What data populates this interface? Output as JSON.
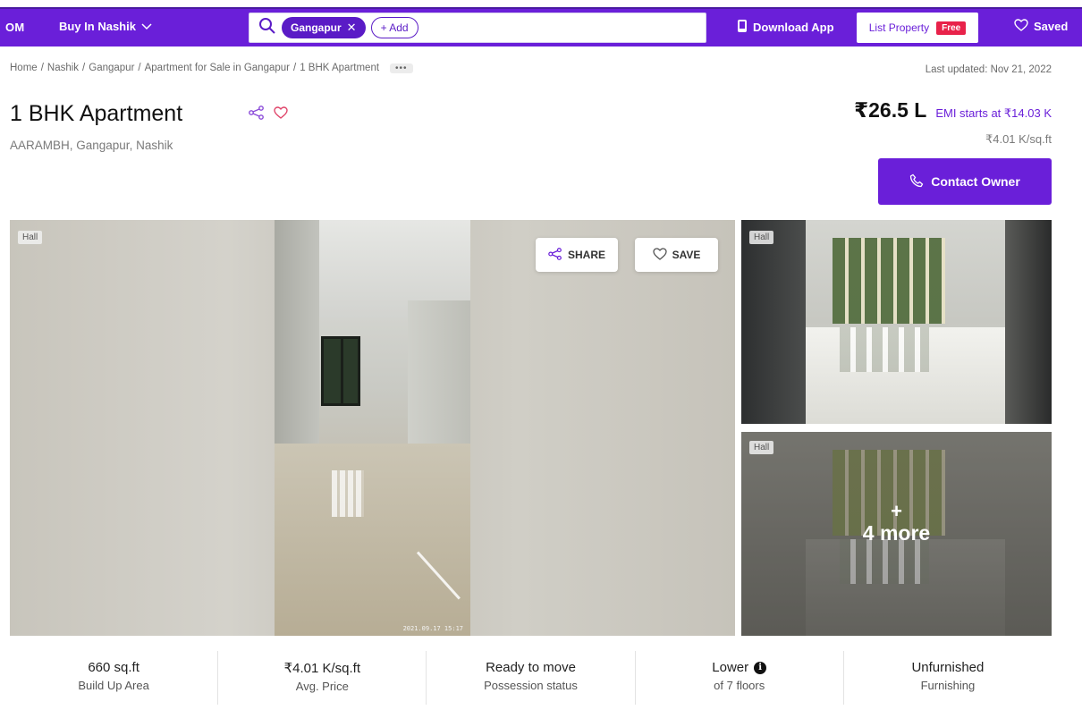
{
  "nav": {
    "brand": "OM",
    "city": "Buy In Nashik",
    "search_chip": "Gangapur",
    "add_label": "+ Add",
    "download_app": "Download App",
    "list_property": "List Property",
    "free_badge": "Free",
    "saved": "Saved",
    "accent_color": "#6a1fd9"
  },
  "breadcrumb": {
    "items": [
      "Home",
      "Nashik",
      "Gangapur",
      "Apartment for Sale in Gangapur",
      "1 BHK Apartment"
    ],
    "separator": "/",
    "more": "•••"
  },
  "last_updated": "Last updated: Nov 21, 2022",
  "listing": {
    "title": "1 BHK Apartment",
    "location": "AARAMBH, Gangapur, Nashik",
    "price": "₹26.5 L",
    "emi": "EMI starts at ₹14.03 K",
    "price_per_sqft": "₹4.01 K/sq.ft",
    "contact_button": "Contact Owner"
  },
  "gallery": {
    "main_tag": "Hall",
    "share_label": "SHARE",
    "save_label": "SAVE",
    "timestamp": "2021.09.17 15:17",
    "thumb1_tag": "Hall",
    "thumb2_tag": "Hall",
    "more_plus": "+",
    "more_label": "4 more"
  },
  "stats": [
    {
      "value": "660 sq.ft",
      "label": "Build Up Area"
    },
    {
      "value": "₹4.01 K/sq.ft",
      "label": "Avg. Price"
    },
    {
      "value": "Ready to move",
      "label": "Possession status"
    },
    {
      "value": "Lower",
      "label": "of 7 floors"
    },
    {
      "value": "Unfurnished",
      "label": "Furnishing"
    }
  ]
}
